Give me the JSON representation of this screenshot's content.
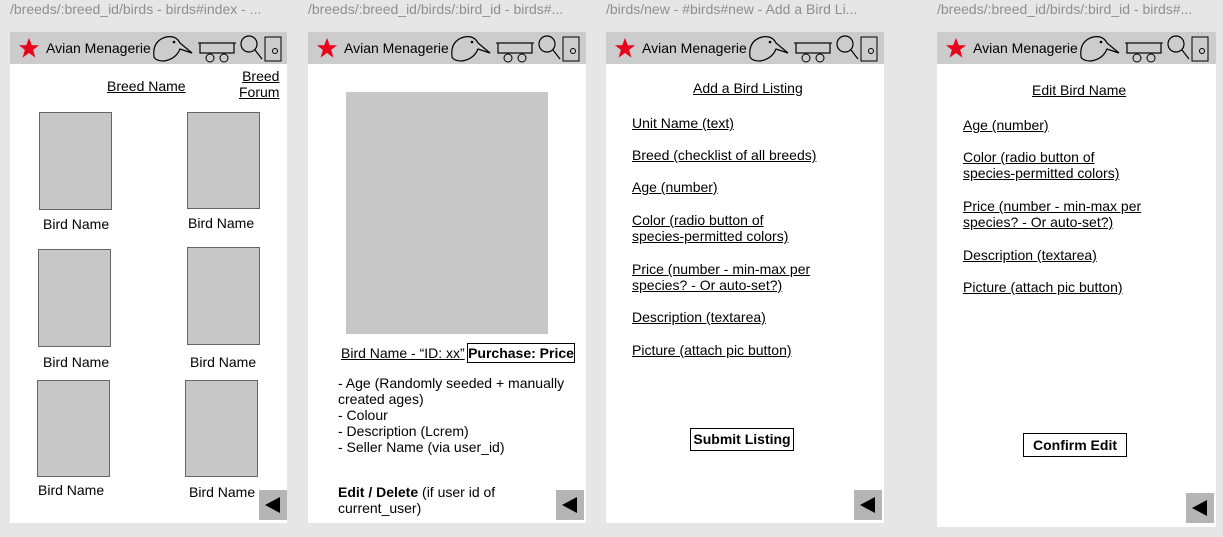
{
  "frames": [
    {
      "title": "/breeds/:breed_id/birds - birds#index - ...",
      "app_name": "Avian Menagerie",
      "breed_name": "Breed Name",
      "breed_forum": "Breed\nForum",
      "bird_label": "Bird Name"
    },
    {
      "title": "/breeds/:breed_id/birds/:bird_id - birds#...",
      "app_name": "Avian Menagerie",
      "bird_name_id": "Bird Name - “ID: xx”",
      "purchase": "Purchase: Price",
      "details": [
        "- Age (Randomly seeded + manually created ages)",
        "- Colour",
        "- Description (Lcrem)",
        "- Seller Name (via user_id)"
      ],
      "edit_delete_bold": "Edit / Delete",
      "edit_delete_rest": " (if user id of current_user)"
    },
    {
      "title": "/birds/new - #birds#new - Add a Bird Li...",
      "app_name": "Avian Menagerie",
      "heading": "Add a Bird Listing",
      "fields": [
        "Unit Name (text)",
        "Breed (checklist of all breeds)",
        "Age (number)",
        "Color (radio button of species-permitted colors)",
        "Price (number - min-max per species? - Or auto-set?)",
        "Description (textarea)",
        "Picture (attach pic button)"
      ],
      "submit": "Submit Listing"
    },
    {
      "title": "/breeds/:breed_id/birds/:bird_id - birds#...",
      "app_name": "Avian Menagerie",
      "heading": "Edit Bird Name",
      "fields": [
        "Age (number)",
        "Color (radio button of species-permitted colors)",
        "Price (number - min-max per species? - Or auto-set?)",
        "Description (textarea)",
        "Picture (attach pic button)"
      ],
      "confirm": "Confirm Edit"
    }
  ],
  "colors": {
    "star": "#e8001c",
    "topbar": "#cccccc",
    "placeholder": "#c7c7c7",
    "canvas": "#e6e6e6"
  },
  "icons": [
    "star-icon",
    "bird-icon",
    "cart-icon",
    "search-icon",
    "phone-icon",
    "back-arrow-icon"
  ]
}
